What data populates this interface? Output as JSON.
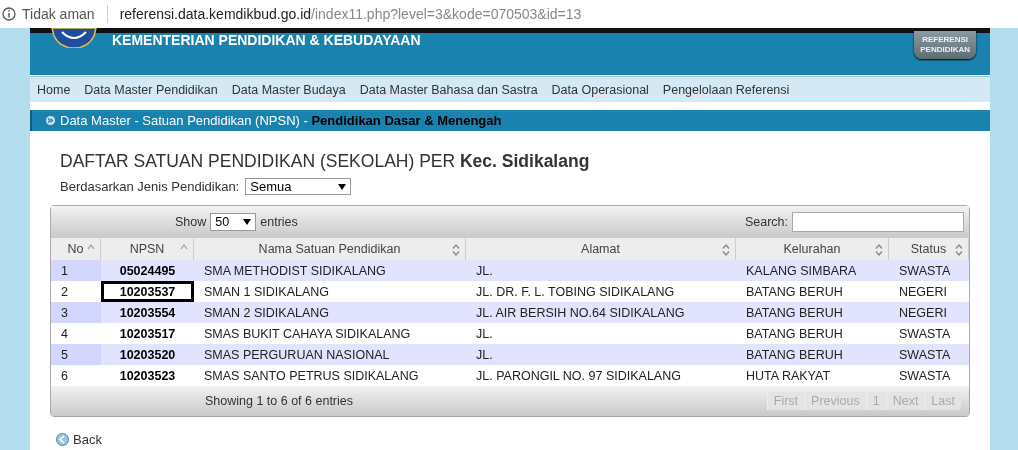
{
  "browser": {
    "security": "Tidak aman",
    "url_host": "referensi.data.kemdikbud.go.id",
    "url_path": "/index11.php?level=3&kode=070503&id=13"
  },
  "header": {
    "title": "KEMENTERIAN PENDIDIKAN & KEBUDAYAAN",
    "badge_line_1": "REFERENSI",
    "badge_line_2": "PENDIDIKAN"
  },
  "nav": [
    {
      "label": "Home"
    },
    {
      "label": "Data Master Pendidikan"
    },
    {
      "label": "Data Master Budaya"
    },
    {
      "label": "Data Master Bahasa dan Sastra"
    },
    {
      "label": "Data Operasional"
    },
    {
      "label": "Pengelolaan Referensi"
    }
  ],
  "breadcrumb": {
    "path": "Data Master - Satuan Pendidikan (NPSN) - ",
    "current": "Pendidikan Dasar & Menengah"
  },
  "heading": {
    "prefix": "DAFTAR SATUAN PENDIDIKAN (SEKOLAH) PER ",
    "place": "Kec. Sidikalang"
  },
  "filter": {
    "label": "Berdasarkan Jenis Pendidikan:",
    "value": "Semua"
  },
  "table": {
    "show_label": "Show",
    "page_size": "50",
    "entries_label": "entries",
    "search_label": "Search:",
    "columns": [
      {
        "label": "No",
        "sorted": true
      },
      {
        "label": "NPSN",
        "sorted": true
      },
      {
        "label": "Nama Satuan Pendidikan",
        "sorted": false
      },
      {
        "label": "Alamat",
        "sorted": false
      },
      {
        "label": "Kelurahan",
        "sorted": false
      },
      {
        "label": "Status",
        "sorted": false
      }
    ],
    "rows": [
      {
        "no": "1",
        "npsn": "05024495",
        "nama": "SMA METHODIST SIDIKALANG",
        "alamat": "JL.",
        "kelurahan": "KALANG SIMBARA",
        "status": "SWASTA",
        "highlighted": false
      },
      {
        "no": "2",
        "npsn": "10203537",
        "nama": "SMAN 1 SIDIKALANG",
        "alamat": "JL. DR. F. L. TOBING SIDIKALANG",
        "kelurahan": "BATANG BERUH",
        "status": "NEGERI",
        "highlighted": true
      },
      {
        "no": "3",
        "npsn": "10203554",
        "nama": "SMAN 2 SIDIKALANG",
        "alamat": "JL. AIR BERSIH NO.64 SIDIKALANG",
        "kelurahan": "BATANG BERUH",
        "status": "NEGERI",
        "highlighted": false
      },
      {
        "no": "4",
        "npsn": "10203517",
        "nama": "SMAS BUKIT CAHAYA SIDIKALANG",
        "alamat": "JL.",
        "kelurahan": "BATANG BERUH",
        "status": "SWASTA",
        "highlighted": false
      },
      {
        "no": "5",
        "npsn": "10203520",
        "nama": "SMAS PERGURUAN NASIONAL",
        "alamat": "JL.",
        "kelurahan": "BATANG BERUH",
        "status": "SWASTA",
        "highlighted": false
      },
      {
        "no": "6",
        "npsn": "10203523",
        "nama": "SMAS SANTO PETRUS SIDIKALANG",
        "alamat": "JL. PARONGIL NO. 97 SIDIKALANG",
        "kelurahan": "HUTA RAKYAT",
        "status": "SWASTA",
        "highlighted": false
      }
    ],
    "info": "Showing 1 to 6 of 6 entries",
    "pager": [
      {
        "label": "First",
        "disabled": true
      },
      {
        "label": "Previous",
        "disabled": true
      },
      {
        "label": "1",
        "disabled": true
      },
      {
        "label": "Next",
        "disabled": true
      },
      {
        "label": "Last",
        "disabled": true
      }
    ]
  },
  "back": {
    "label": "Back"
  }
}
